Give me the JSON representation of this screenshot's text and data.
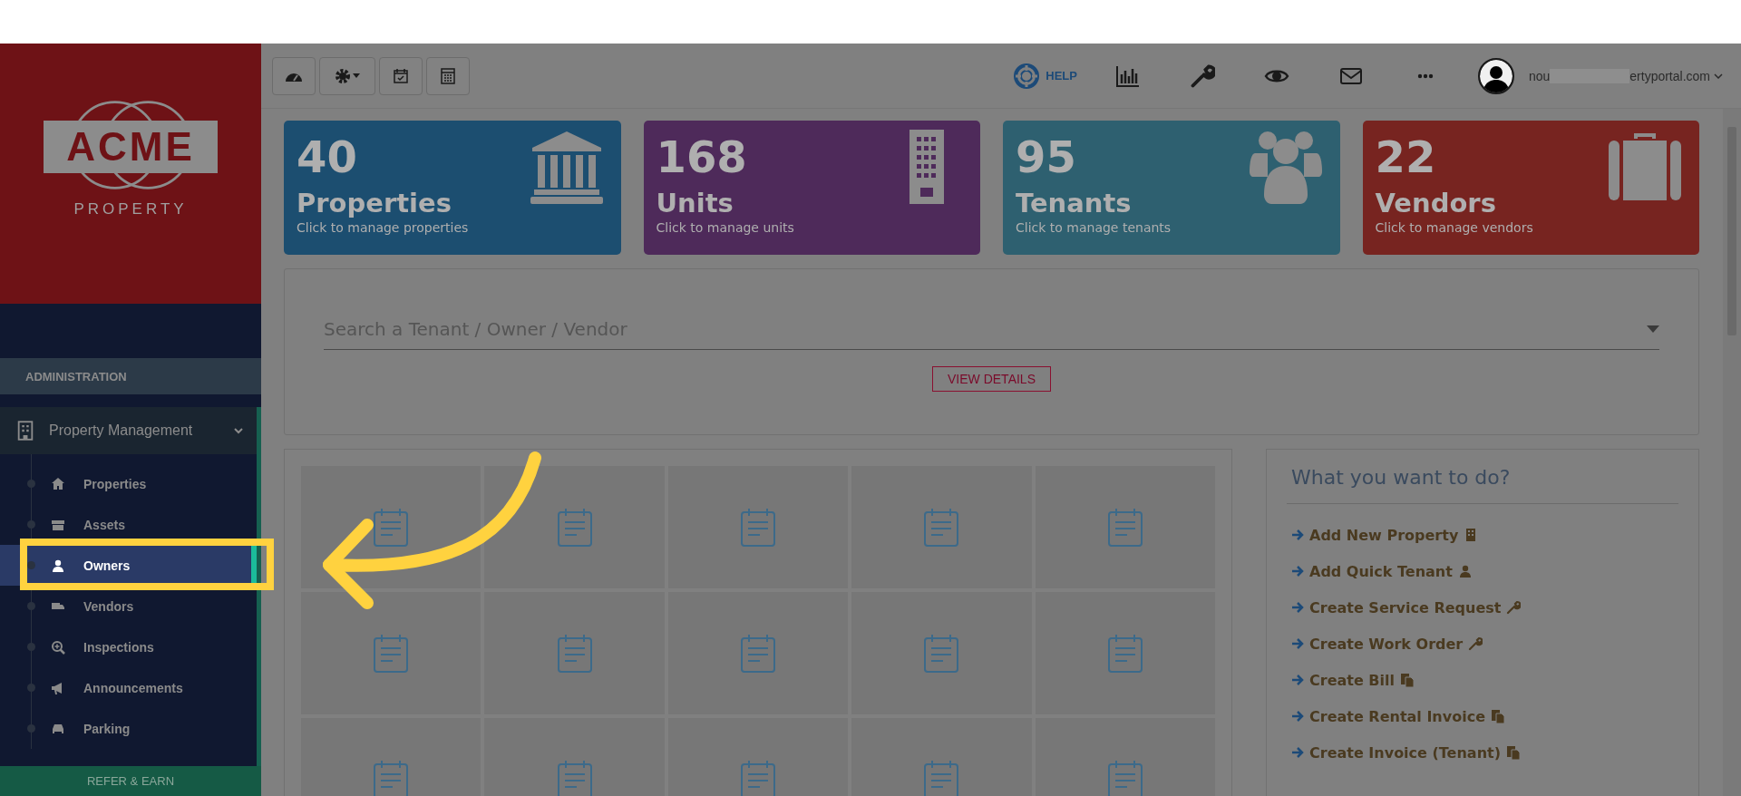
{
  "logo": {
    "name": "ACME",
    "subtitle": "PROPERTY"
  },
  "sidebar": {
    "section_title": "ADMINISTRATION",
    "group": {
      "label": "Property Management",
      "expanded": true
    },
    "items": [
      {
        "label": "Properties",
        "selected": false
      },
      {
        "label": "Assets",
        "selected": false
      },
      {
        "label": "Owners",
        "selected": true
      },
      {
        "label": "Vendors",
        "selected": false
      },
      {
        "label": "Inspections",
        "selected": false
      },
      {
        "label": "Announcements",
        "selected": false
      },
      {
        "label": "Parking",
        "selected": false
      }
    ],
    "footer_button": "REFER & EARN"
  },
  "header": {
    "help": "HELP",
    "user_email_start": "nou",
    "user_email_end": "ertyportal.com"
  },
  "stats": [
    {
      "count": "40",
      "title": "Properties",
      "subtitle": "Click to manage properties",
      "color": "#1c4e70"
    },
    {
      "count": "168",
      "title": "Units",
      "subtitle": "Click to manage units",
      "color": "#4e2a5a"
    },
    {
      "count": "95",
      "title": "Tenants",
      "subtitle": "Click to manage tenants",
      "color": "#2e6070"
    },
    {
      "count": "22",
      "title": "Vendors",
      "subtitle": "Click to manage vendors",
      "color": "#772420"
    }
  ],
  "search": {
    "placeholder": "Search a Tenant / Owner / Vendor",
    "button": "VIEW DETAILS"
  },
  "quick_actions": {
    "title": "What you want to do?",
    "items": [
      "Add New Property",
      "Add Quick Tenant",
      "Create Service Request",
      "Create Work Order",
      "Create Bill",
      "Create Rental Invoice",
      "Create Invoice (Tenant)"
    ]
  }
}
